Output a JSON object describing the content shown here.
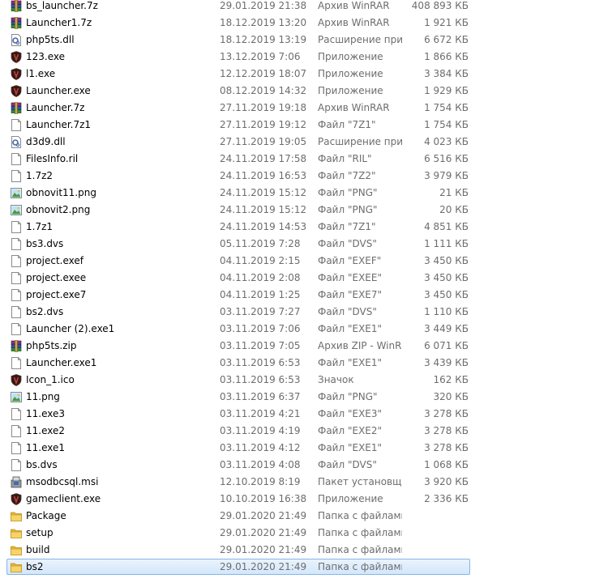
{
  "files": [
    {
      "name": "bs_launcher.7z",
      "date": "29.01.2019 21:38",
      "type": "Архив WinRAR",
      "size": "408 893 КБ",
      "icon": "winrar-archive-icon"
    },
    {
      "name": "Launcher1.7z",
      "date": "18.12.2019 13:20",
      "type": "Архив WinRAR",
      "size": "1 921 КБ",
      "icon": "winrar-archive-icon"
    },
    {
      "name": "php5ts.dll",
      "date": "18.12.2019 13:19",
      "type": "Расширение при...",
      "size": "6 672 КБ",
      "icon": "dll-file-icon"
    },
    {
      "name": "123.exe",
      "date": "13.12.2019 7:06",
      "type": "Приложение",
      "size": "1 866 КБ",
      "icon": "app-shield-icon"
    },
    {
      "name": "l1.exe",
      "date": "12.12.2019 18:07",
      "type": "Приложение",
      "size": "3 384 КБ",
      "icon": "app-shield-icon"
    },
    {
      "name": "Launcher.exe",
      "date": "08.12.2019 14:32",
      "type": "Приложение",
      "size": "1 929 КБ",
      "icon": "app-shield-icon"
    },
    {
      "name": "Launcher.7z",
      "date": "27.11.2019 19:18",
      "type": "Архив WinRAR",
      "size": "1 754 КБ",
      "icon": "winrar-archive-icon"
    },
    {
      "name": "Launcher.7z1",
      "date": "27.11.2019 19:12",
      "type": "Файл \"7Z1\"",
      "size": "1 754 КБ",
      "icon": "blank-file-icon"
    },
    {
      "name": "d3d9.dll",
      "date": "27.11.2019 19:05",
      "type": "Расширение при...",
      "size": "4 023 КБ",
      "icon": "dll-file-icon"
    },
    {
      "name": "FilesInfo.ril",
      "date": "24.11.2019 17:58",
      "type": "Файл \"RIL\"",
      "size": "6 516 КБ",
      "icon": "blank-file-icon"
    },
    {
      "name": "1.7z2",
      "date": "24.11.2019 16:53",
      "type": "Файл \"7Z2\"",
      "size": "3 979 КБ",
      "icon": "blank-file-icon"
    },
    {
      "name": "obnovit11.png",
      "date": "24.11.2019 15:12",
      "type": "Файл \"PNG\"",
      "size": "21 КБ",
      "icon": "image-file-icon"
    },
    {
      "name": "obnovit2.png",
      "date": "24.11.2019 15:12",
      "type": "Файл \"PNG\"",
      "size": "20 КБ",
      "icon": "image-file-icon"
    },
    {
      "name": "1.7z1",
      "date": "24.11.2019 14:53",
      "type": "Файл \"7Z1\"",
      "size": "4 851 КБ",
      "icon": "blank-file-icon"
    },
    {
      "name": "bs3.dvs",
      "date": "05.11.2019 7:28",
      "type": "Файл \"DVS\"",
      "size": "1 111 КБ",
      "icon": "blank-file-icon"
    },
    {
      "name": "project.exef",
      "date": "04.11.2019 2:15",
      "type": "Файл \"EXEF\"",
      "size": "3 450 КБ",
      "icon": "blank-file-icon"
    },
    {
      "name": "project.exee",
      "date": "04.11.2019 2:08",
      "type": "Файл \"EXEE\"",
      "size": "3 450 КБ",
      "icon": "blank-file-icon"
    },
    {
      "name": "project.exe7",
      "date": "04.11.2019 1:25",
      "type": "Файл \"EXE7\"",
      "size": "3 450 КБ",
      "icon": "blank-file-icon"
    },
    {
      "name": "bs2.dvs",
      "date": "03.11.2019 7:27",
      "type": "Файл \"DVS\"",
      "size": "1 110 КБ",
      "icon": "blank-file-icon"
    },
    {
      "name": "Launcher (2).exe1",
      "date": "03.11.2019 7:06",
      "type": "Файл \"EXE1\"",
      "size": "3 449 КБ",
      "icon": "blank-file-icon"
    },
    {
      "name": "php5ts.zip",
      "date": "03.11.2019 7:05",
      "type": "Архив ZIP - WinR...",
      "size": "6 071 КБ",
      "icon": "winrar-archive-icon"
    },
    {
      "name": "Launcher.exe1",
      "date": "03.11.2019 6:53",
      "type": "Файл \"EXE1\"",
      "size": "3 439 КБ",
      "icon": "blank-file-icon"
    },
    {
      "name": "Icon_1.ico",
      "date": "03.11.2019 6:53",
      "type": "Значок",
      "size": "162 КБ",
      "icon": "app-shield-icon"
    },
    {
      "name": "11.png",
      "date": "03.11.2019 6:37",
      "type": "Файл \"PNG\"",
      "size": "320 КБ",
      "icon": "image-file-icon"
    },
    {
      "name": "11.exe3",
      "date": "03.11.2019 4:21",
      "type": "Файл \"EXE3\"",
      "size": "3 278 КБ",
      "icon": "blank-file-icon"
    },
    {
      "name": "11.exe2",
      "date": "03.11.2019 4:19",
      "type": "Файл \"EXE2\"",
      "size": "3 278 КБ",
      "icon": "blank-file-icon"
    },
    {
      "name": "11.exe1",
      "date": "03.11.2019 4:12",
      "type": "Файл \"EXE1\"",
      "size": "3 278 КБ",
      "icon": "blank-file-icon"
    },
    {
      "name": "bs.dvs",
      "date": "03.11.2019 4:08",
      "type": "Файл \"DVS\"",
      "size": "1 068 КБ",
      "icon": "blank-file-icon"
    },
    {
      "name": "msodbcsql.msi",
      "date": "12.10.2019 8:19",
      "type": "Пакет установщи...",
      "size": "3 920 КБ",
      "icon": "msi-installer-icon"
    },
    {
      "name": "gameclient.exe",
      "date": "10.10.2019 16:38",
      "type": "Приложение",
      "size": "2 336 КБ",
      "icon": "app-shield-icon"
    },
    {
      "name": "Package",
      "date": "29.01.2020 21:49",
      "type": "Папка с файлами",
      "size": "",
      "icon": "folder-icon"
    },
    {
      "name": "setup",
      "date": "29.01.2020 21:49",
      "type": "Папка с файлами",
      "size": "",
      "icon": "folder-icon"
    },
    {
      "name": "build",
      "date": "29.01.2020 21:49",
      "type": "Папка с файлами",
      "size": "",
      "icon": "folder-icon"
    },
    {
      "name": "bs2",
      "date": "29.01.2020 21:49",
      "type": "Папка с файлами",
      "size": "",
      "icon": "folder-icon",
      "selected": true
    }
  ]
}
